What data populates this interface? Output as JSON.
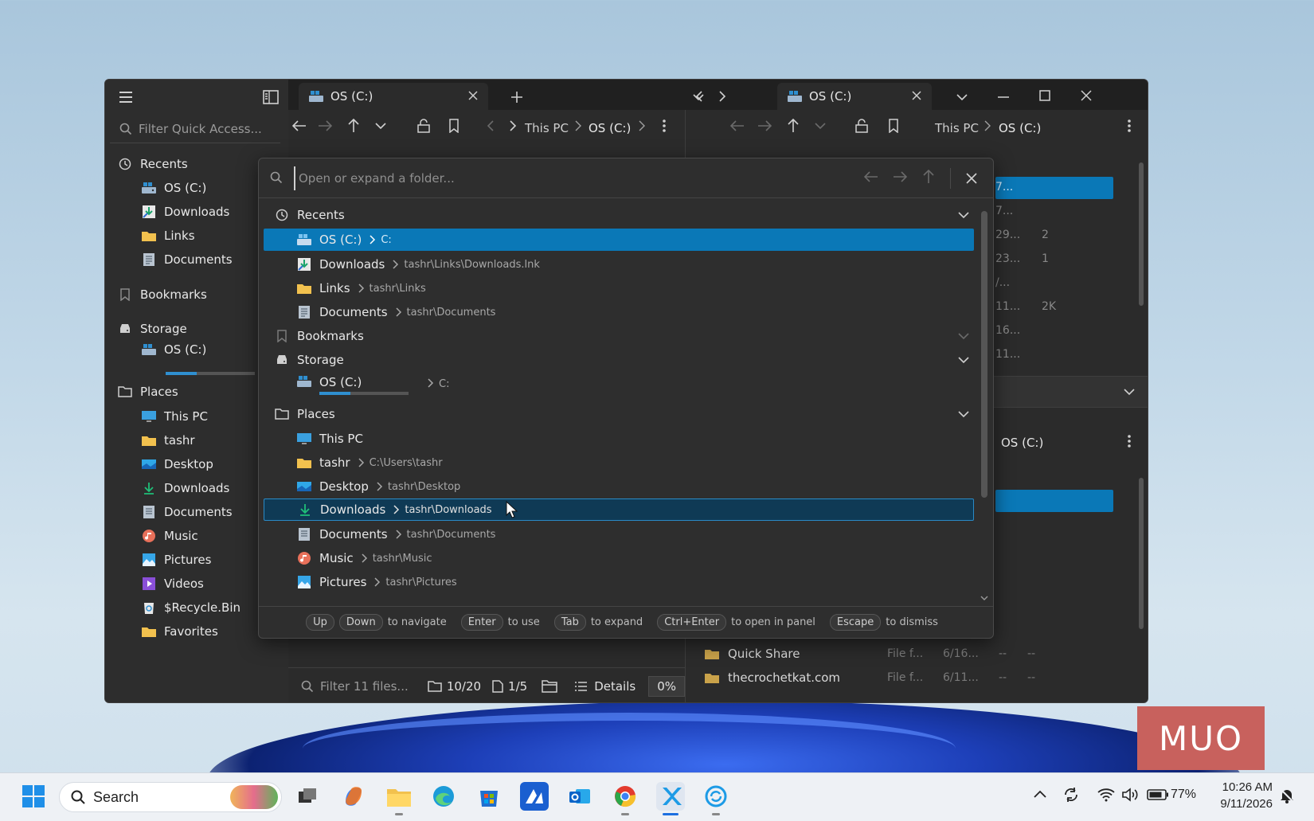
{
  "sidebar": {
    "filter_placeholder": "Filter Quick Access...",
    "recents_title": "Recents",
    "recents": [
      "OS (C:)",
      "Downloads",
      "Links",
      "Documents"
    ],
    "bookmarks_title": "Bookmarks",
    "storage_title": "Storage",
    "storage_drive": "OS (C:)",
    "storage_usage": 0.35,
    "places_title": "Places",
    "places": [
      "This PC",
      "tashr",
      "Desktop",
      "Downloads",
      "Documents",
      "Music",
      "Pictures",
      "Videos",
      "$Recycle.Bin",
      "Favorites"
    ]
  },
  "left_panel": {
    "tab_title": "OS (C:)",
    "breadcrumb": [
      "This PC",
      "OS (C:)"
    ],
    "status": {
      "filter_placeholder": "Filter 11 files...",
      "folders": "10/20",
      "files": "1/5",
      "view": "Details",
      "progress": "0%"
    }
  },
  "right_panel": {
    "tab_title": "OS (C:)",
    "breadcrumb": [
      "This PC",
      "OS (C:)"
    ],
    "second_title": "OS (C:)",
    "visible_rows": [
      {
        "name": "Quick Share",
        "type": "File f...",
        "date": "6/16...",
        "c1": "--",
        "c2": "--"
      },
      {
        "name": "thecrochetkat.com",
        "type": "File f...",
        "date": "6/11...",
        "c1": "--",
        "c2": "--"
      }
    ],
    "partial_date_cells": [
      "7...",
      "7...",
      "29...",
      "23...",
      "/...",
      "11...",
      "16...",
      "11..."
    ],
    "size_cells": [
      "2",
      "1",
      "2K"
    ]
  },
  "overlay": {
    "search_placeholder": "Open or expand a folder...",
    "sections": {
      "recents": "Recents",
      "bookmarks": "Bookmarks",
      "storage": "Storage",
      "places": "Places"
    },
    "recents": [
      {
        "name": "OS (C:)",
        "path": "C:"
      },
      {
        "name": "Downloads",
        "path": "tashr\\Links\\Downloads.lnk"
      },
      {
        "name": "Links",
        "path": "tashr\\Links"
      },
      {
        "name": "Documents",
        "path": "tashr\\Documents"
      }
    ],
    "storage": [
      {
        "name": "OS (C:)",
        "path": "C:",
        "usage": 0.35
      }
    ],
    "places": [
      {
        "name": "This PC",
        "path": ""
      },
      {
        "name": "tashr",
        "path": "C:\\Users\\tashr"
      },
      {
        "name": "Desktop",
        "path": "tashr\\Desktop"
      },
      {
        "name": "Downloads",
        "path": "tashr\\Downloads"
      },
      {
        "name": "Documents",
        "path": "tashr\\Documents"
      },
      {
        "name": "Music",
        "path": "tashr\\Music"
      },
      {
        "name": "Pictures",
        "path": "tashr\\Pictures"
      }
    ],
    "footer": {
      "up": "Up",
      "down": "Down",
      "navigate": "to navigate",
      "enter": "Enter",
      "use": "to use",
      "tab": "Tab",
      "expand": "to expand",
      "ctrl_enter": "Ctrl+Enter",
      "open_panel": "to open in panel",
      "escape": "Escape",
      "dismiss": "to dismiss"
    }
  },
  "taskbar": {
    "search_placeholder": "Search",
    "battery": "77%",
    "time": "10:26 AM",
    "date": "9/11/2026"
  },
  "watermark": "MUO",
  "colors": {
    "accent": "#0a78b7",
    "folder": "#f2c14e",
    "window_bg": "#2b2b2b",
    "watermark_bg": "#c8615d"
  }
}
